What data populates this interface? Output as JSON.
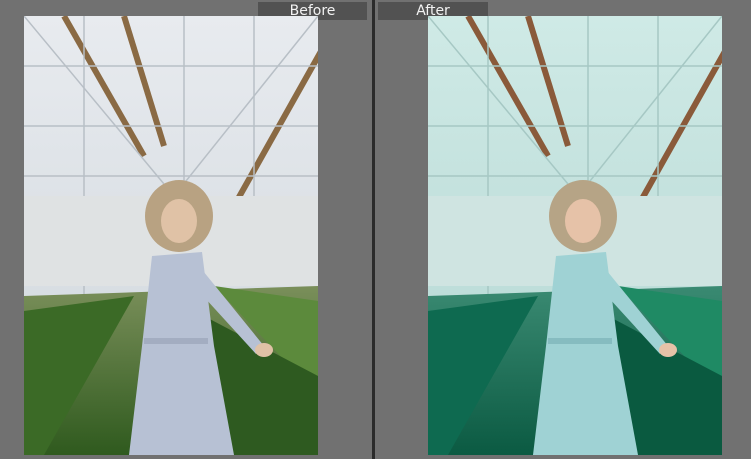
{
  "before_label": "Before",
  "after_label": "After",
  "colors": {
    "background": "#717171",
    "tab": "#525252",
    "divider": "#2b2b2b"
  },
  "photos": {
    "before": {
      "tone": "neutral",
      "plants": "#3f6a2a",
      "sky": "#e3e7ec",
      "dress": "#b9c3d6"
    },
    "after": {
      "tone": "teal",
      "plants": "#0f6a52",
      "sky": "#c6e3e0",
      "dress": "#9ad0d4"
    }
  }
}
